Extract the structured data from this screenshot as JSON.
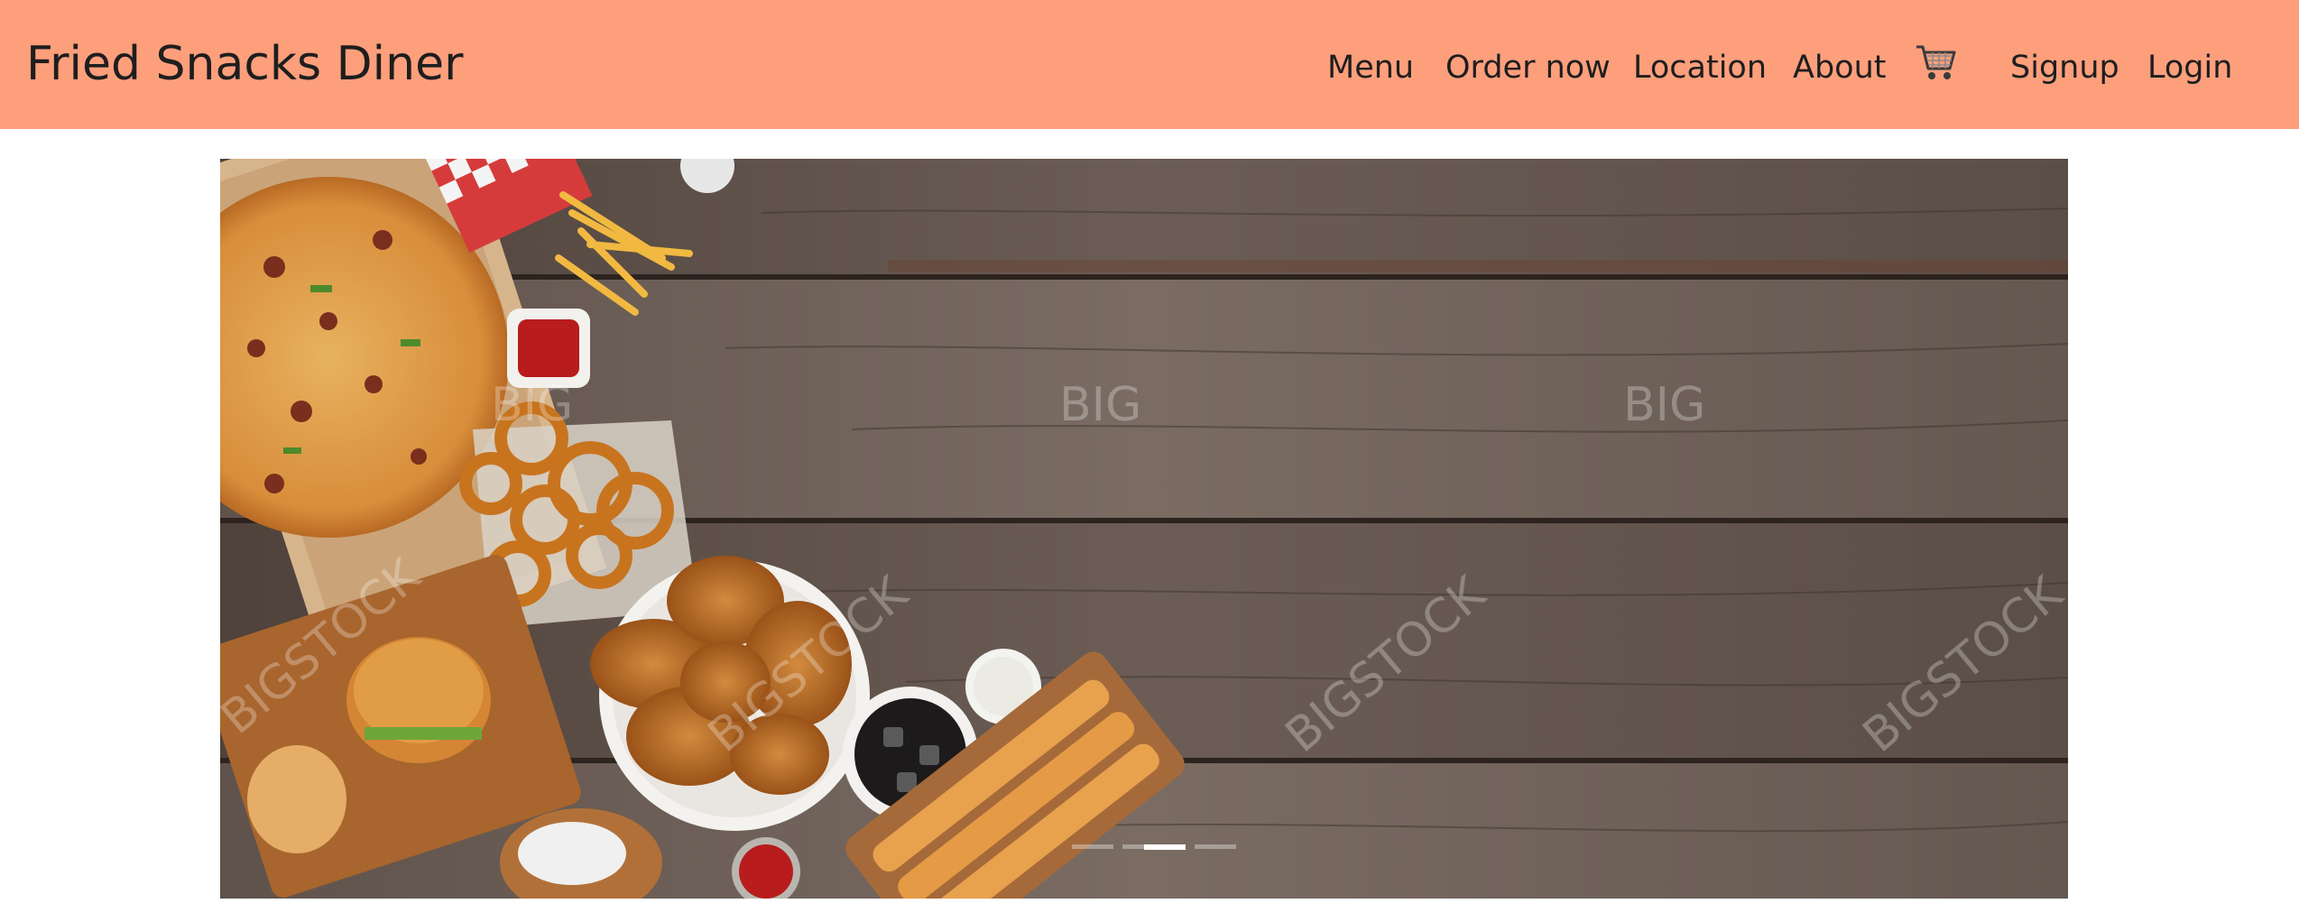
{
  "navbar": {
    "brand": "Fried Snacks Diner",
    "links": [
      {
        "label": "Menu"
      },
      {
        "label": "Order now"
      },
      {
        "label": "Location"
      },
      {
        "label": "About"
      }
    ],
    "cart_icon": "shopping-cart-icon",
    "signup": "Signup",
    "login": "Login",
    "background_color": "#fe9f7c"
  },
  "carousel": {
    "watermark": "BIGSTOCK",
    "watermark_short": "BIG",
    "slide_count": 4,
    "active_slide": 3
  }
}
